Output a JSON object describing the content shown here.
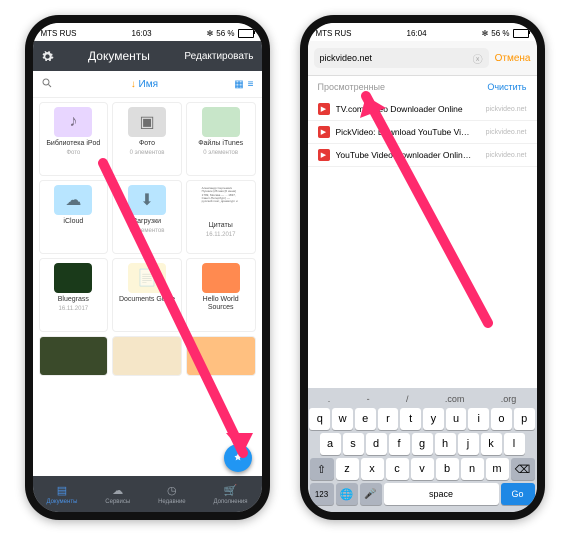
{
  "status": {
    "carrier": "MTS RUS",
    "time1": "16:03",
    "time2": "16:04",
    "battery": "56 %",
    "bt": "✻"
  },
  "p1": {
    "title": "Документы",
    "edit": "Редактировать",
    "sort_label": "Имя",
    "items": [
      {
        "name": "Библиотека iPod",
        "meta": "Фото",
        "thumb": "folder",
        "color": "#e8d6ff",
        "glyph": "♪"
      },
      {
        "name": "Фото",
        "meta": "0 элементов",
        "thumb": "folder",
        "color": "#ddd",
        "glyph": "▣"
      },
      {
        "name": "Файлы iTunes",
        "meta": "0 элементов",
        "thumb": "folder",
        "color": "#c8e6c9",
        "glyph": ""
      },
      {
        "name": "iCloud",
        "meta": "",
        "thumb": "folder",
        "color": "#b8e5ff",
        "glyph": "☁"
      },
      {
        "name": "Загрузки",
        "meta": "0 элементов",
        "thumb": "folder",
        "color": "#b8e5ff",
        "glyph": "⬇"
      },
      {
        "name": "Цитаты",
        "meta": "16.11.2017",
        "thumb": "doc",
        "color": "#fff",
        "glyph": "Александр Сергеевич Пушкин (26 мая [6 июня] 1799, Москва — ... 1837, Санкт-Петербург) — русский поэт, драматург и"
      },
      {
        "name": "Bluegrass",
        "meta": "16.11.2017",
        "thumb": "img",
        "color": "#1a3a1a",
        "glyph": ""
      },
      {
        "name": "Documents Guide",
        "meta": "",
        "thumb": "doc",
        "color": "#fdf6d8",
        "glyph": "📄"
      },
      {
        "name": "Hello World Sources",
        "meta": "",
        "thumb": "img",
        "color": "#ff8a50",
        "glyph": ""
      }
    ],
    "tabs": [
      {
        "label": "Документы",
        "icon": "▤",
        "active": true
      },
      {
        "label": "Сервисы",
        "icon": "☁",
        "active": false
      },
      {
        "label": "Недавние",
        "icon": "◷",
        "active": false
      },
      {
        "label": "Дополнения",
        "icon": "🛒",
        "active": false
      }
    ],
    "fab_icon": "✎"
  },
  "p2": {
    "url": "pickvideo.net",
    "cancel": "Отмена",
    "section": "Просмотренные",
    "clear": "Очистить",
    "suggestions": [
      {
        "title": "TV.com Video Downloader Online",
        "domain": "pickvideo.net"
      },
      {
        "title": "PickVideo: Download YouTube Vi…",
        "domain": "pickvideo.net"
      },
      {
        "title": "YouTube Video Downloader Onlin…",
        "domain": "pickvideo.net"
      }
    ],
    "kb_top": [
      ".",
      "-",
      "/",
      ".com",
      ".org"
    ],
    "kb_r1": [
      "q",
      "w",
      "e",
      "r",
      "t",
      "y",
      "u",
      "i",
      "o",
      "p"
    ],
    "kb_r2": [
      "a",
      "s",
      "d",
      "f",
      "g",
      "h",
      "j",
      "k",
      "l"
    ],
    "kb_r3": [
      "⇧",
      "z",
      "x",
      "c",
      "v",
      "b",
      "n",
      "m",
      "⌫"
    ],
    "kb_num": "123",
    "kb_space": "space",
    "kb_go": "Go"
  }
}
